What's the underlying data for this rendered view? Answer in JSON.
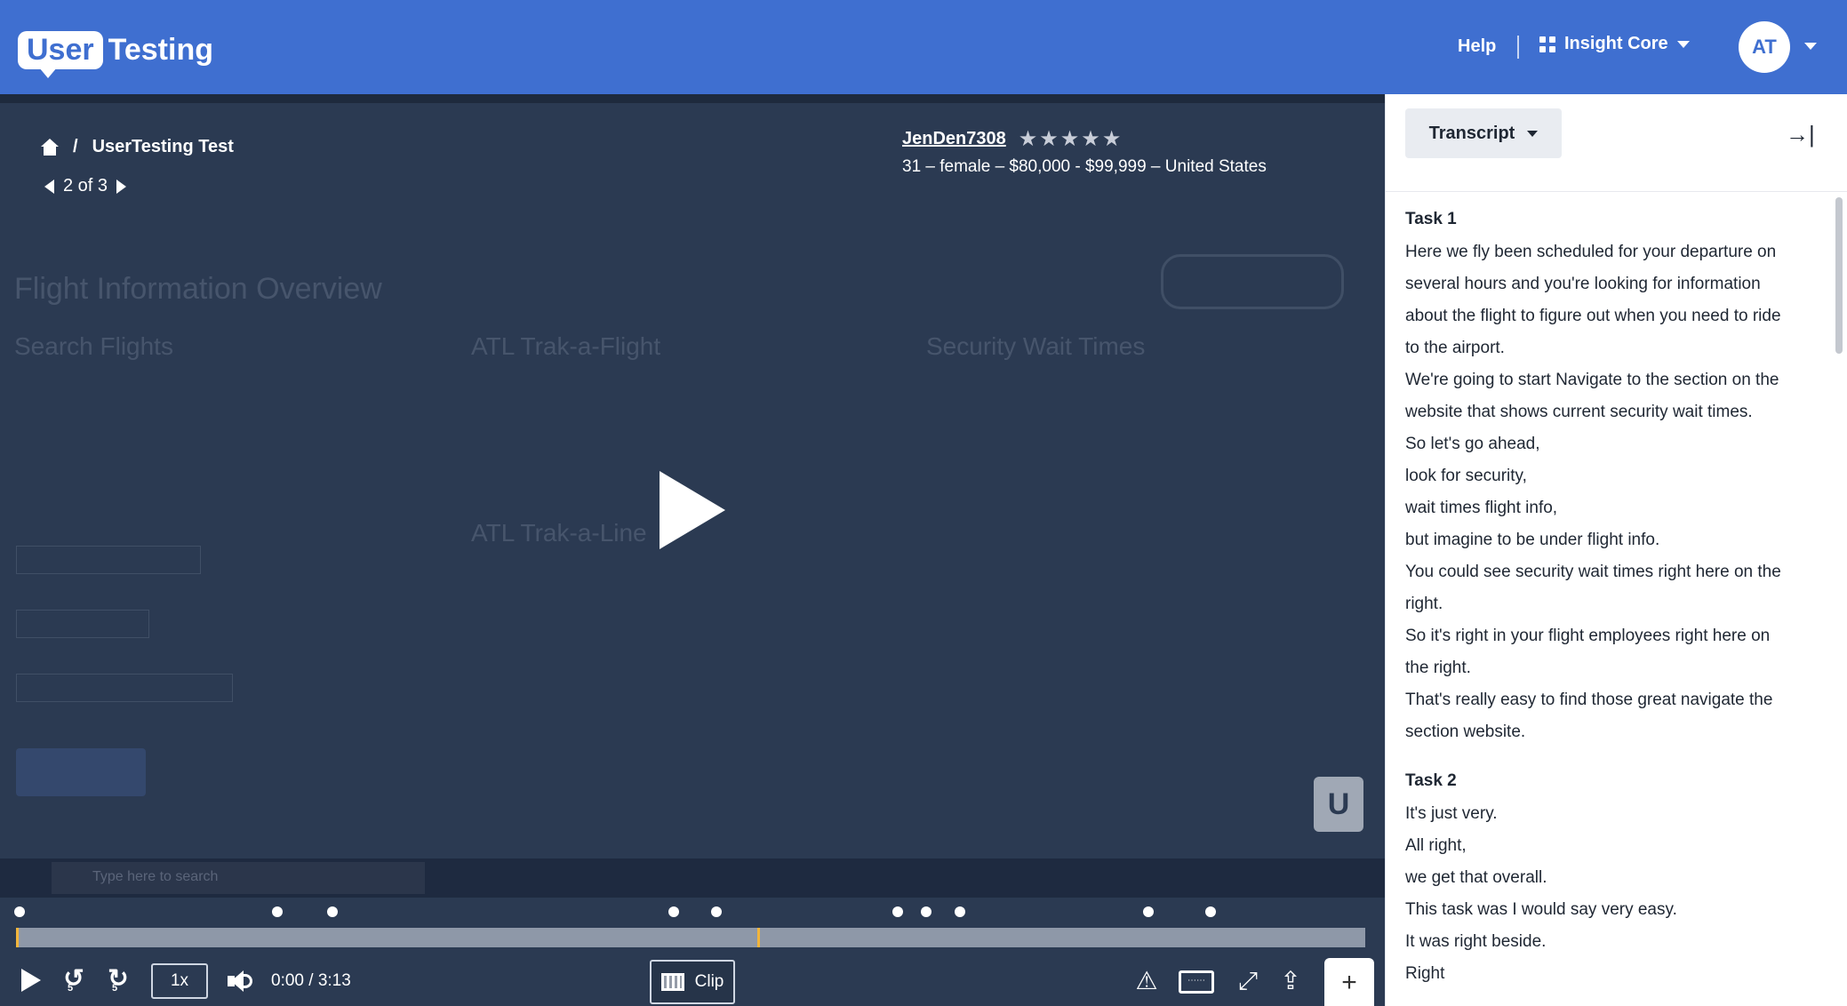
{
  "header": {
    "logo_user": "User",
    "logo_testing": "Testing",
    "help_label": "Help",
    "product_label": "Insight Core",
    "avatar_initials": "AT",
    "color": "#3f6fd0"
  },
  "video": {
    "breadcrumb_sep": "/",
    "breadcrumb_title": "UserTesting Test",
    "pager_label": "2 of 3",
    "tester_name": "JenDen7308",
    "tester_stars": "★★★★★",
    "tester_meta": "31 – female – $80,000 - $99,999 – United States",
    "u_badge": "U",
    "background": {
      "title": "Flight Information Overview",
      "search_flights": "Search Flights",
      "trak_a_flight": "ATL Trak-a-Flight",
      "trak_a_line": "ATL Trak-a-Line",
      "security_wait": "Security Wait Times",
      "taskbar_search": "Type here to search"
    }
  },
  "controls": {
    "speed": "1x",
    "current_time": "0:00",
    "time_sep": "/",
    "duration": "3:13",
    "clip_label": "Clip",
    "rewind_seconds": "5",
    "forward_seconds": "5",
    "plus_label": "+"
  },
  "transcript": {
    "button_label": "Transcript",
    "tasks": [
      {
        "title": "Task 1",
        "lines": [
          "Here we fly been scheduled for your departure on",
          "several hours and you're looking for information",
          "about the flight to figure out when you need to ride",
          "to the airport.",
          "We're going to start Navigate to the section on the",
          "website that shows current security wait times.",
          "So let's go ahead,",
          "look for security,",
          "wait times flight info,",
          "but imagine to be under flight info.",
          "You could see security wait times right here on the",
          "right.",
          "So it's right in your flight employees right here on",
          "the right.",
          "That's really easy to find those great navigate the",
          "section website."
        ]
      },
      {
        "title": "Task 2",
        "lines": [
          "It's just very.",
          "All right,",
          "we get that overall.",
          "This task was I would say very easy.",
          "It was right beside.",
          "Right"
        ]
      }
    ]
  }
}
